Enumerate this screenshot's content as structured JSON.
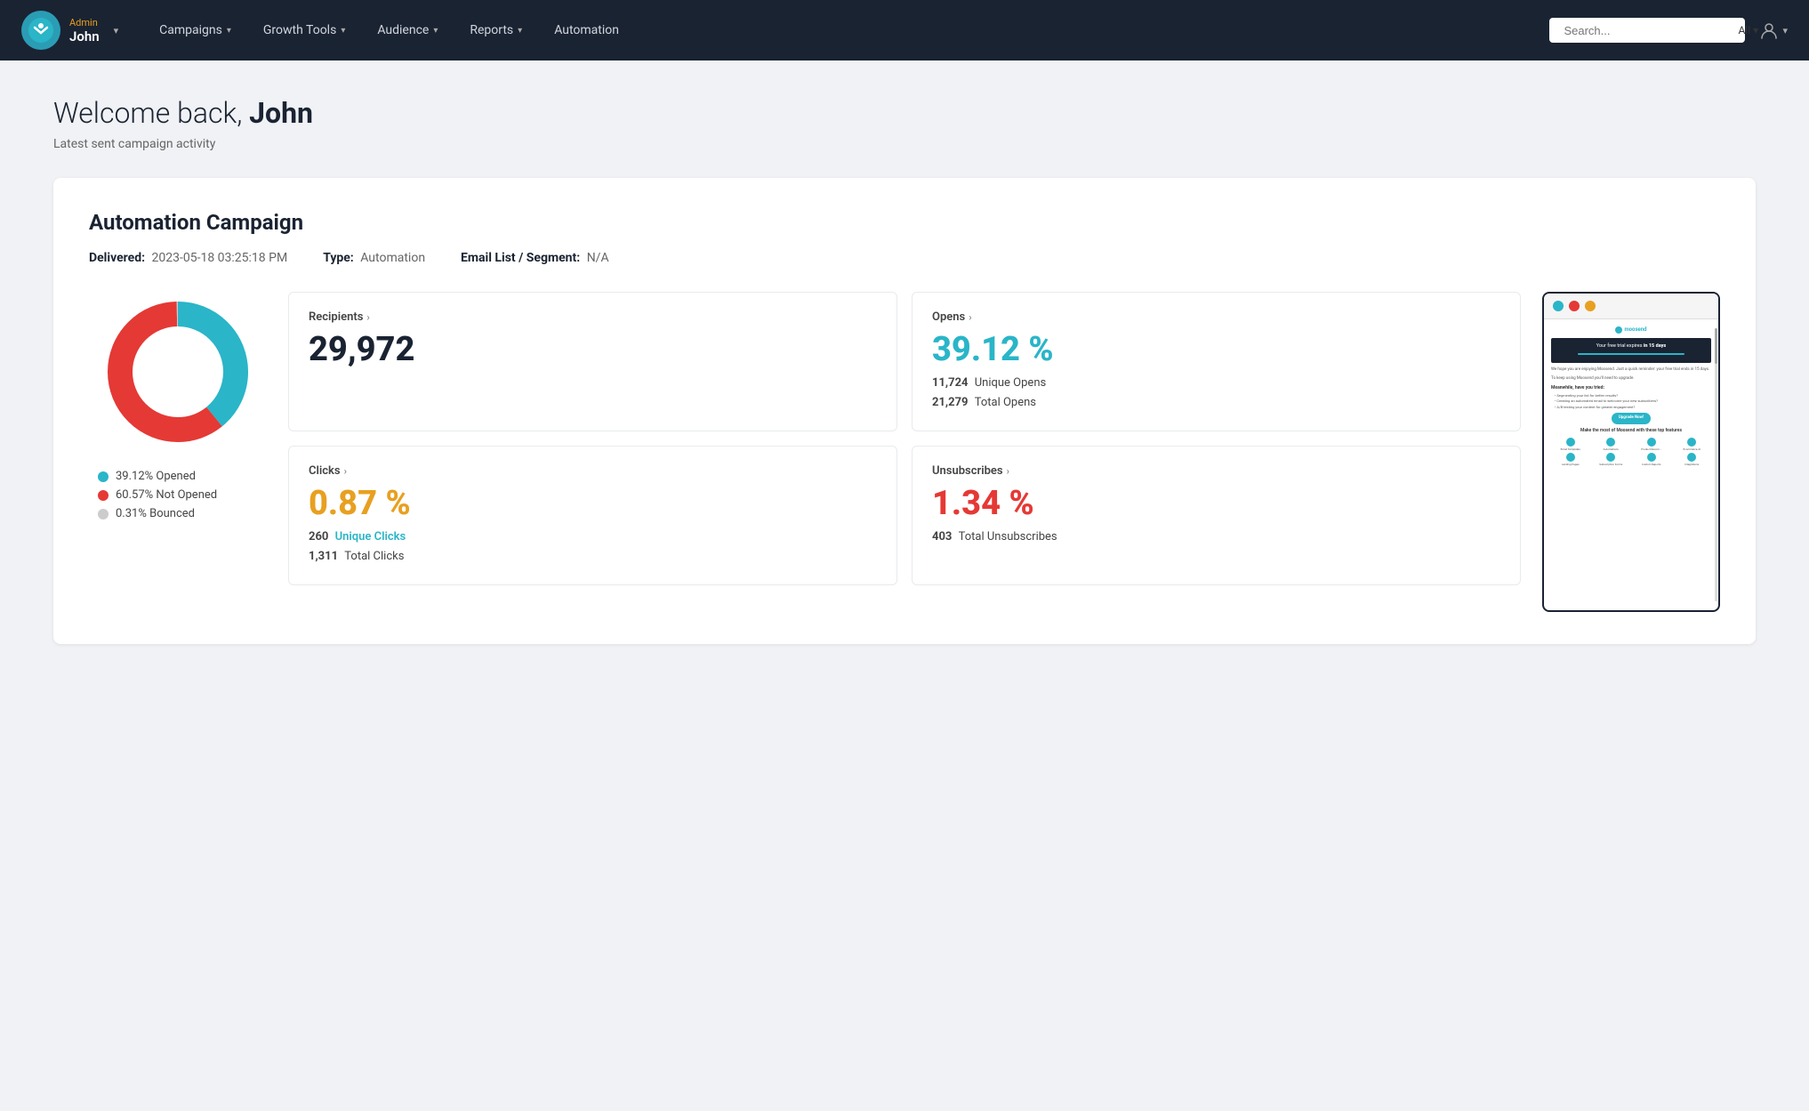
{
  "navbar": {
    "admin_label": "Admin",
    "username": "John",
    "nav_items": [
      {
        "label": "Campaigns",
        "has_dropdown": true
      },
      {
        "label": "Growth Tools",
        "has_dropdown": true
      },
      {
        "label": "Audience",
        "has_dropdown": true
      },
      {
        "label": "Reports",
        "has_dropdown": true
      },
      {
        "label": "Automation",
        "has_dropdown": false
      }
    ],
    "search_placeholder": "Search...",
    "search_filter": "All"
  },
  "welcome": {
    "greeting": "Welcome back,",
    "username": "John",
    "subtitle": "Latest sent campaign activity"
  },
  "campaign": {
    "title": "Automation Campaign",
    "delivered_label": "Delivered:",
    "delivered_value": "2023-05-18 03:25:18 PM",
    "type_label": "Type:",
    "type_value": "Automation",
    "email_list_label": "Email List / Segment:",
    "email_list_value": "N/A"
  },
  "stats": {
    "donut": {
      "opened_pct": 39.12,
      "not_opened_pct": 60.57,
      "bounced_pct": 0.31,
      "legend": [
        {
          "label": "39.12% Opened",
          "color": "#2ab5c8"
        },
        {
          "label": "60.57% Not Opened",
          "color": "#e53935"
        },
        {
          "label": "0.31% Bounced",
          "color": "#cccccc"
        }
      ]
    },
    "recipients": {
      "header": "Recipients",
      "value": "29,972"
    },
    "opens": {
      "header": "Opens",
      "percentage": "39.12 %",
      "unique_label": "Unique Opens",
      "unique_value": "11,724",
      "total_label": "Total Opens",
      "total_value": "21,279"
    },
    "clicks": {
      "header": "Clicks",
      "percentage": "0.87 %",
      "unique_label": "Unique Clicks",
      "unique_value": "260",
      "total_label": "Total Clicks",
      "total_value": "1,311"
    },
    "unsubscribes": {
      "header": "Unsubscribes",
      "percentage": "1.34 %",
      "total_label": "Total Unsubscribes",
      "total_value": "403"
    }
  },
  "email_preview": {
    "title_dots": [
      "teal",
      "red",
      "yellow"
    ],
    "logo_text": "moosend",
    "hero_text": "Your free trial expires in 15 days",
    "body_text_1": "We hope you are enjoying Moosend. Just a quick reminder: your free trial ends in 15 days.",
    "body_text_2": "To keep using Moosend you'll need to upgrade.",
    "section_title": "Meanwhile, have you tried:",
    "bullets": [
      "• Segmenting your list for better results?",
      "• Creating an automated email to welcome your new subscribers?",
      "• A/B testing your content for greater engagement?"
    ],
    "cta": "Upgrade Now!",
    "features_title": "Make the most of Moosend with these top features",
    "features": [
      "Email Templates",
      "Automations",
      "Product Recommendations",
      "Ecommerce AI",
      "Landing Pages",
      "Subscription Forms",
      "Custom Reports",
      "Integrations"
    ]
  }
}
